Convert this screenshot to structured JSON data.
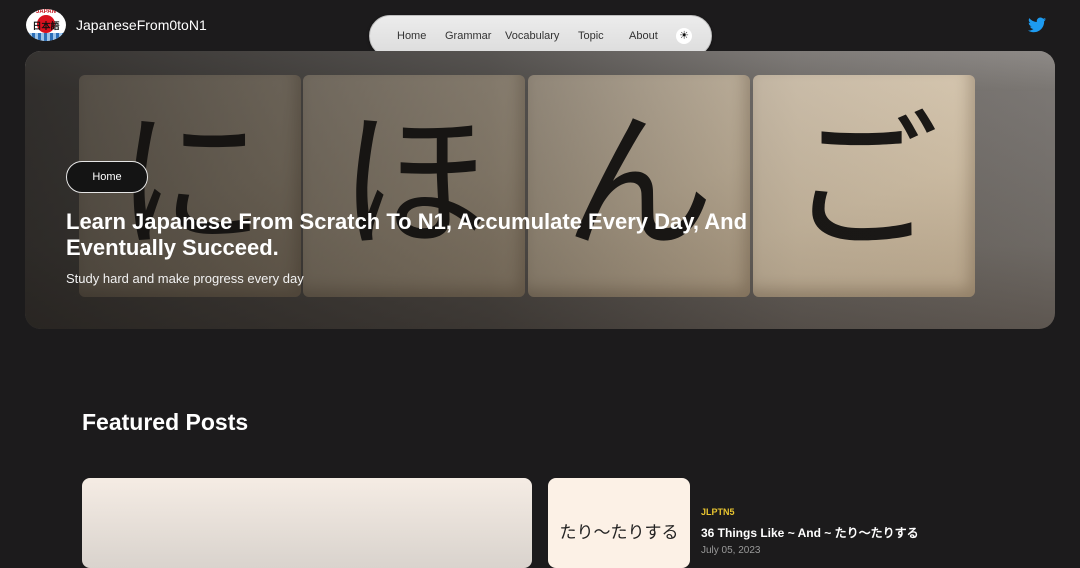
{
  "header": {
    "logo_top": "JAPAN",
    "logo_mid": "日本語",
    "site_title": "JapaneseFrom0toN1",
    "twitter_color": "#1d9bf0"
  },
  "nav": {
    "items": [
      {
        "label": "Home"
      },
      {
        "label": "Grammar"
      },
      {
        "label": "Vocabulary"
      },
      {
        "label": "Topic"
      },
      {
        "label": "About"
      }
    ],
    "theme_icon": "☀"
  },
  "hero": {
    "blocks": [
      "に",
      "ほ",
      "ん",
      "ご"
    ],
    "breadcrumb": "Home",
    "title": "Learn Japanese From Scratch To N1, Accumulate Every Day, And Eventually Succeed.",
    "subtitle": "Study hard and make progress every day"
  },
  "featured": {
    "heading": "Featured Posts",
    "side_post": {
      "thumb_text": "たり〜たりする",
      "tag": "JLPTN5",
      "title": "36 Things Like ~ And ~ たり〜たりする",
      "date": "July 05, 2023"
    }
  },
  "colors": {
    "background": "#1c1b1c",
    "tag": "#e8c530"
  }
}
